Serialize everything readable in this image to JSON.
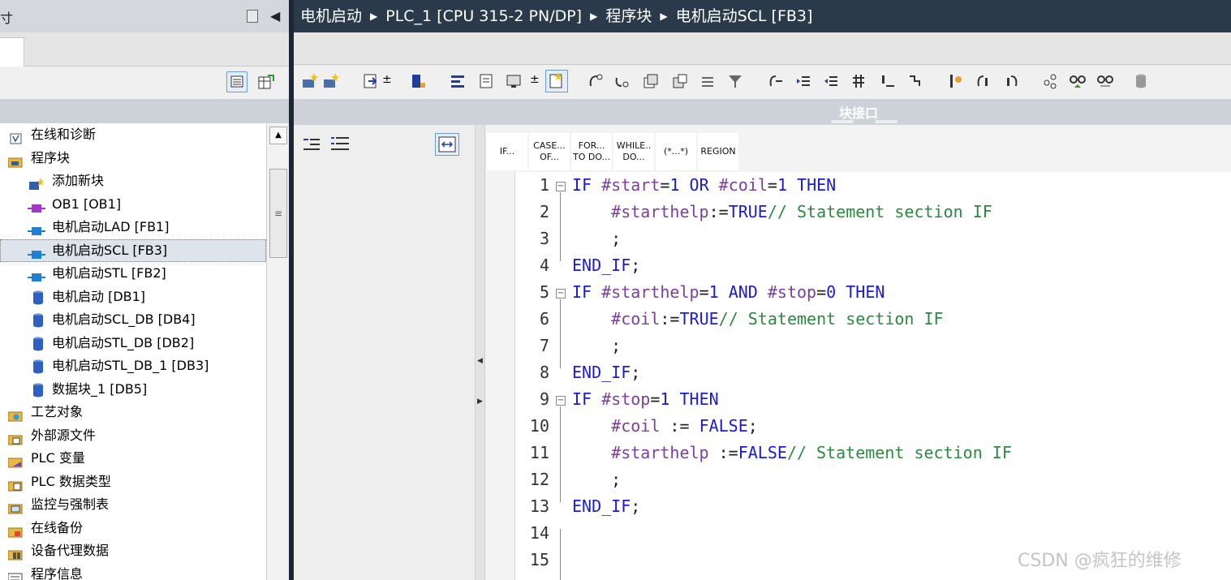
{
  "breadcrumb": {
    "items": [
      "电机启动",
      "PLC_1 [CPU 315-2 PN/DP]",
      "程序块",
      "电机启动SCL [FB3]"
    ]
  },
  "left_title": {
    "text": "寸"
  },
  "tree": {
    "items": [
      {
        "label": "在线和诊断",
        "icon": "diagnostics-icon",
        "indent": 0
      },
      {
        "label": "程序块",
        "icon": "program-blocks-folder-icon",
        "indent": 0
      },
      {
        "label": "添加新块",
        "icon": "add-block-icon",
        "indent": 1
      },
      {
        "label": "OB1 [OB1]",
        "icon": "ob-block-icon",
        "indent": 1
      },
      {
        "label": "电机启动LAD [FB1]",
        "icon": "fb-block-icon",
        "indent": 1
      },
      {
        "label": "电机启动SCL [FB3]",
        "icon": "fb-block-icon",
        "indent": 1,
        "selected": true
      },
      {
        "label": "电机启动STL [FB2]",
        "icon": "fb-block-icon",
        "indent": 1
      },
      {
        "label": "电机启动 [DB1]",
        "icon": "db-block-icon",
        "indent": 1
      },
      {
        "label": "电机启动SCL_DB [DB4]",
        "icon": "db-block-icon",
        "indent": 1
      },
      {
        "label": "电机启动STL_DB [DB2]",
        "icon": "db-block-icon",
        "indent": 1
      },
      {
        "label": "电机启动STL_DB_1 [DB3]",
        "icon": "db-block-icon",
        "indent": 1
      },
      {
        "label": "数据块_1 [DB5]",
        "icon": "db-block-icon",
        "indent": 1
      },
      {
        "label": "工艺对象",
        "icon": "technology-objects-icon",
        "indent": 0
      },
      {
        "label": "外部源文件",
        "icon": "external-source-icon",
        "indent": 0
      },
      {
        "label": "PLC 变量",
        "icon": "plc-tags-icon",
        "indent": 0
      },
      {
        "label": "PLC 数据类型",
        "icon": "plc-datatypes-icon",
        "indent": 0
      },
      {
        "label": "监控与强制表",
        "icon": "watch-table-icon",
        "indent": 0
      },
      {
        "label": "在线备份",
        "icon": "online-backup-icon",
        "indent": 0
      },
      {
        "label": "设备代理数据",
        "icon": "device-proxy-icon",
        "indent": 0
      },
      {
        "label": "程序信息",
        "icon": "program-info-icon",
        "indent": 0
      }
    ]
  },
  "interface_bar": {
    "label": "块接口"
  },
  "instructions": [
    {
      "line1": "IF...",
      "line2": ""
    },
    {
      "line1": "CASE...",
      "line2": "OF..."
    },
    {
      "line1": "FOR...",
      "line2": "TO DO..."
    },
    {
      "line1": "WHILE..",
      "line2": "DO..."
    },
    {
      "line1": "(*...*)",
      "line2": ""
    },
    {
      "line1": "REGION",
      "line2": ""
    }
  ],
  "code": {
    "line_numbers": [
      "1",
      "2",
      "3",
      "4",
      "5",
      "6",
      "7",
      "8",
      "9",
      "10",
      "11",
      "12",
      "13",
      "14",
      "15"
    ],
    "lines": [
      "IF #start=1 OR #coil=1 THEN",
      "    #starthelp:=TRUE// Statement section IF",
      "    ;",
      "END_IF;",
      "IF #starthelp=1 AND #stop=0 THEN",
      "    #coil:=TRUE// Statement section IF",
      "    ;",
      "END_IF;",
      "IF #stop=1 THEN",
      "    #coil := FALSE;",
      "    #starthelp :=FALSE// Statement section IF",
      "    ;",
      "END_IF;",
      "",
      ""
    ]
  },
  "watermark": "CSDN @疯狂的维修",
  "colors": {
    "keyword": "#1b1bd6",
    "variable": "#7b3f9e",
    "comment": "#2b8a3e",
    "breadcrumb_bg": "#2b3a4a",
    "header_bg": "#cdd2d8"
  }
}
